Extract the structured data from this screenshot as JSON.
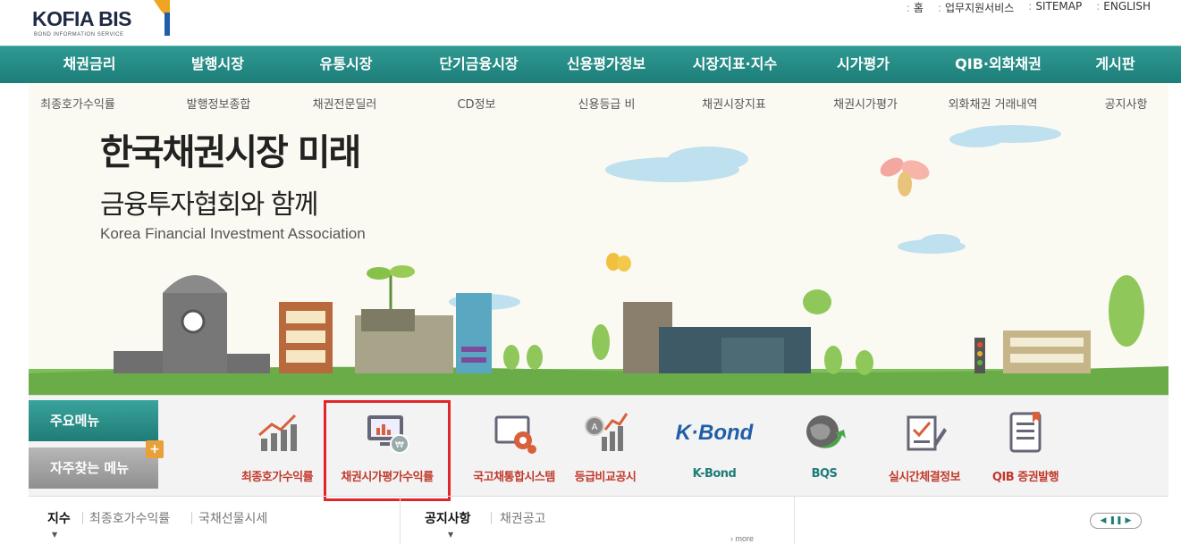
{
  "header": {
    "logo_text": "KOFIA BIS",
    "logo_sub": "BOND INFORMATION SERVICE",
    "util_links": [
      "홈",
      "업무지원서비스",
      "SITEMAP",
      "ENGLISH"
    ]
  },
  "nav": {
    "items": [
      "채권금리",
      "발행시장",
      "유통시장",
      "단기금융시장",
      "신용평가정보",
      "시장지표·지수",
      "시가평가",
      "QIB·외화채권",
      "게시판"
    ]
  },
  "subnav": {
    "items": [
      "최종호가수익률",
      "발행정보종합",
      "채권전문딜러",
      "CD정보",
      "신용등급 비교공시",
      "채권시장지표",
      "채권시가평가기준수익",
      "외화채권 거래내역",
      "공지사항"
    ]
  },
  "banner": {
    "headline1": "한국채권시장 미래",
    "headline2": "금융투자협회와 함께",
    "headline3": "Korea Financial Investment Association"
  },
  "quick": {
    "tab_main": "주요메뉴",
    "tab_fav": "자주찾는 메뉴",
    "tab_fav_plus": "+",
    "items": [
      {
        "label": "최종호가수익률",
        "icon": "rising-bar-chart-icon"
      },
      {
        "label": "채권시가평가수익률",
        "icon": "monitor-chart-coin-icon"
      },
      {
        "label": "국고채통합시스템",
        "icon": "screen-gear-icon"
      },
      {
        "label": "등급비교공시",
        "icon": "medal-bar-chart-icon"
      },
      {
        "label": "K-Bond",
        "icon": "k-bond-logo-icon"
      },
      {
        "label": "BQS",
        "icon": "globe-arrow-icon"
      },
      {
        "label": "실시간체결정보",
        "icon": "checklist-pen-icon"
      },
      {
        "label": "QIB 증권발행",
        "icon": "document-bookmark-icon"
      }
    ],
    "kbond_logo": "K·Bond"
  },
  "bottom": {
    "left_tabs": [
      "지수",
      "최종호가수익률",
      "국채선물시세"
    ],
    "mid_tabs": [
      "공지사항",
      "채권공고"
    ],
    "more": "› more",
    "ctrl": [
      "◀",
      "❚❚",
      "▶"
    ]
  },
  "colors": {
    "nav_teal": "#1d7d78",
    "accent_red": "#c0392b",
    "selection_border": "#e0262a"
  }
}
